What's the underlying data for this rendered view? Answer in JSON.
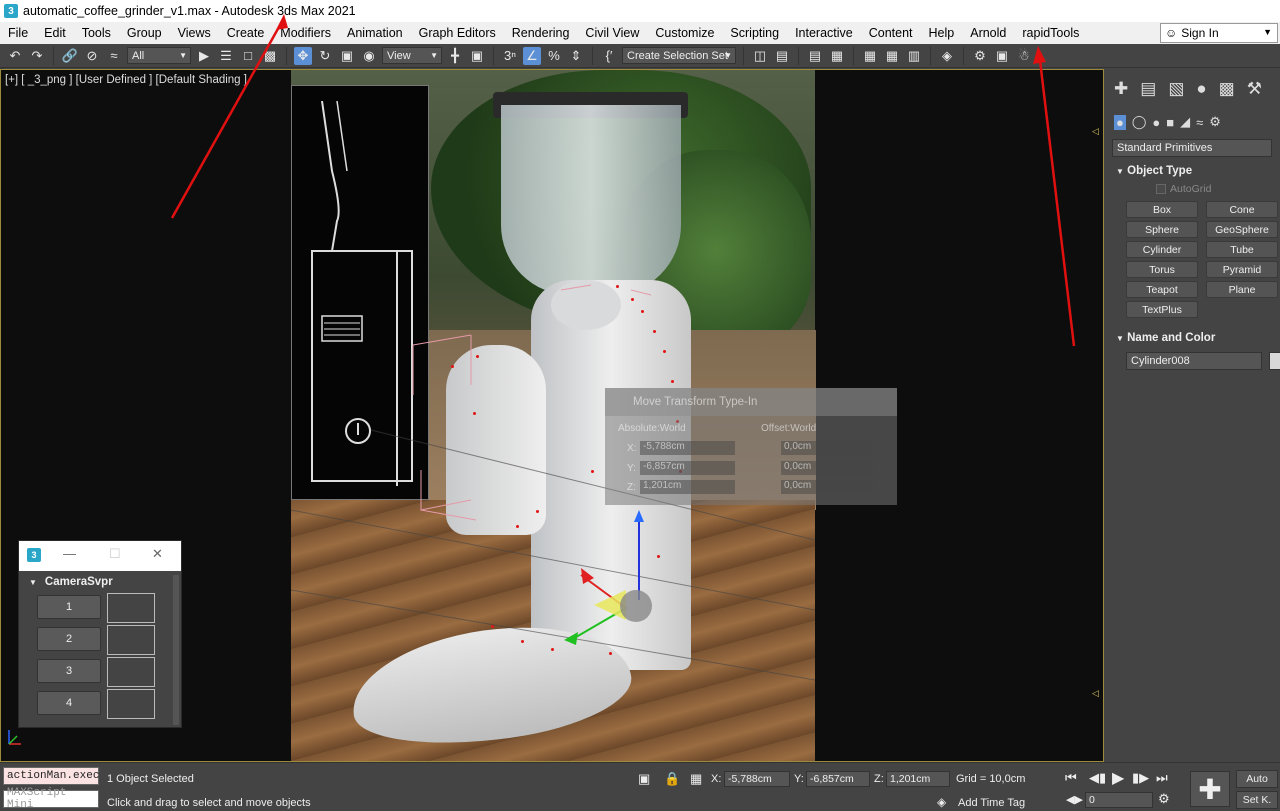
{
  "titlebar": {
    "title": "automatic_coffee_grinder_v1.max - Autodesk 3ds Max 2021",
    "icon_letter": "3"
  },
  "menu": [
    "File",
    "Edit",
    "Tools",
    "Group",
    "Views",
    "Create",
    "Modifiers",
    "Animation",
    "Graph Editors",
    "Rendering",
    "Civil View",
    "Customize",
    "Scripting",
    "Interactive",
    "Content",
    "Help",
    "Arnold",
    "rapidTools"
  ],
  "signin": {
    "label": "Sign In"
  },
  "toolbar": {
    "filter": "All",
    "ref_coord": "View",
    "selection_set": "Create Selection Set"
  },
  "viewport": {
    "label": "[+] [ _3_png ] [User Defined ] [Default Shading ]"
  },
  "typein": {
    "title": "Move Transform Type-In",
    "absolute": "Absolute:World",
    "offset": "Offset:World",
    "x_label": "X:",
    "y_label": "Y:",
    "z_label": "Z:",
    "x": "-5,788cm",
    "y": "-6,857cm",
    "z": "1,201cm",
    "ox": "0,0cm",
    "oy": "0,0cm",
    "oz": "0,0cm"
  },
  "camwin": {
    "title": "CameraSvpr",
    "buttons": [
      "1",
      "2",
      "3",
      "4"
    ]
  },
  "command_panel": {
    "category": "Standard Primitives",
    "object_type_title": "Object Type",
    "autogrid": "AutoGrid",
    "objects": [
      "Box",
      "Cone",
      "Sphere",
      "GeoSphere",
      "Cylinder",
      "Tube",
      "Torus",
      "Pyramid",
      "Teapot",
      "Plane",
      "TextPlus"
    ],
    "name_color_title": "Name and Color",
    "object_name": "Cylinder008",
    "object_color": "#d8d8d8"
  },
  "status": {
    "script_line1": "actionMan.exec",
    "script_line2": "MAXScript Mini",
    "selected": "1 Object Selected",
    "prompt": "Click and drag to select and move objects",
    "x_label": "X:",
    "y_label": "Y:",
    "z_label": "Z:",
    "x": "-5,788cm",
    "y": "-6,857cm",
    "z": "1,201cm",
    "grid": "Grid = 10,0cm",
    "add_time_tag": "Add Time Tag",
    "frame": "0",
    "auto": "Auto",
    "setkey": "Set K."
  },
  "colors": {
    "accent_active": "#5b8fd6",
    "viewport_border": "#9b8b3a",
    "annotation_arrow": "#e01010"
  }
}
